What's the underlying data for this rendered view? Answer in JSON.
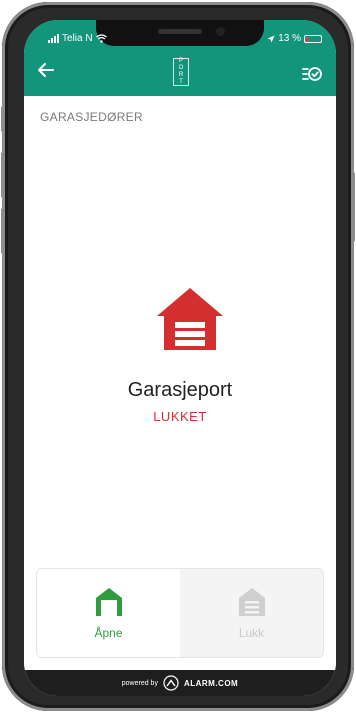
{
  "status_bar": {
    "carrier": "Telia N",
    "battery": "13 %"
  },
  "header": {
    "back_icon": "arrow-left-icon",
    "logo_text": [
      "P",
      "O",
      "R",
      "T"
    ],
    "menu_icon": "list-check-icon"
  },
  "section": {
    "title": "GARASJEDØRER"
  },
  "device": {
    "name": "Garasjeport",
    "state": "LUKKET",
    "state_color": "#d32f2f",
    "icon": "garage-door-icon"
  },
  "actions": {
    "open_label": "Åpne",
    "close_label": "Lukk"
  },
  "footer": {
    "powered_by": "powered by",
    "brand": "ALARM.COM"
  },
  "colors": {
    "header": "#13957c",
    "accent_green": "#2e9d3d",
    "status_red": "#d32f2f"
  }
}
